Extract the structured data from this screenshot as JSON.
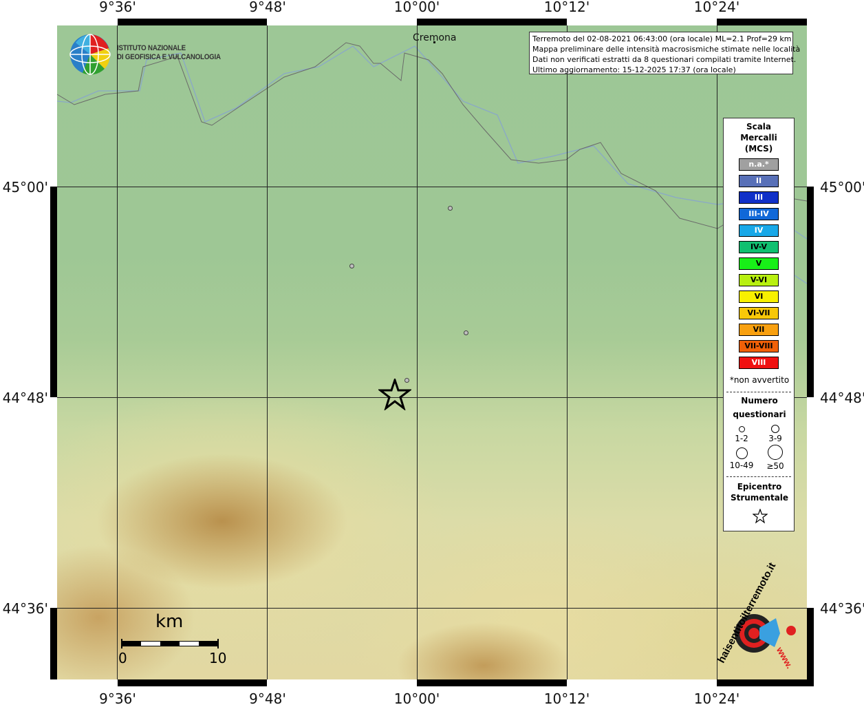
{
  "coordinates": {
    "top": [
      "9°36'",
      "9°48'",
      "10°00'",
      "10°12'",
      "10°24'"
    ],
    "bottom": [
      "9°36'",
      "9°48'",
      "10°00'",
      "10°12'",
      "10°24'"
    ],
    "left": [
      "45°00'",
      "44°48'",
      "44°36'"
    ],
    "right": [
      "45°00'",
      "44°48'",
      "44°36'"
    ]
  },
  "city": "Cremona",
  "logo": {
    "line1": "ISTITUTO NAZIONALE",
    "line2": "DI GEOFISICA E VULCANOLOGIA"
  },
  "info": {
    "line1": "Terremoto del 02-08-2021 06:43:00 (ora locale) ML=2.1 Prof=29 km",
    "line2": "Mappa preliminare delle intensità macrosismiche stimate nelle località",
    "line3": "Dati non verificati estratti da 8 questionari compilati tramite Internet.",
    "line4": "Ultimo aggiornamento: 15-12-2025 17:37 (ora locale)"
  },
  "legend": {
    "title_lines": [
      "Scala",
      "Mercalli",
      "(MCS)"
    ],
    "scale": [
      {
        "label": "n.a.*",
        "color": "#a0a0a0",
        "text_color": "#ffffff"
      },
      {
        "label": "II",
        "color": "#5870b8",
        "text_color": "#ffffff"
      },
      {
        "label": "III",
        "color": "#1030c8",
        "text_color": "#ffffff"
      },
      {
        "label": "III-IV",
        "color": "#1068d8",
        "text_color": "#ffffff"
      },
      {
        "label": "IV",
        "color": "#18a8e8",
        "text_color": "#ffffff"
      },
      {
        "label": "IV-V",
        "color": "#10c070",
        "text_color": "#000000"
      },
      {
        "label": "V",
        "color": "#18f018",
        "text_color": "#000000"
      },
      {
        "label": "V-VI",
        "color": "#b8f010",
        "text_color": "#000000"
      },
      {
        "label": "VI",
        "color": "#f8f000",
        "text_color": "#000000"
      },
      {
        "label": "VI-VII",
        "color": "#f8c808",
        "text_color": "#000000"
      },
      {
        "label": "VII",
        "color": "#f8a010",
        "text_color": "#000000"
      },
      {
        "label": "VII-VIII",
        "color": "#f06008",
        "text_color": "#000000"
      },
      {
        "label": "VIII",
        "color": "#f01010",
        "text_color": "#ffffff"
      }
    ],
    "note": "*non avvertito",
    "questionnaires_title_lines": [
      "Numero",
      "questionari"
    ],
    "questionnaire_sizes": [
      "1-2",
      "3-9",
      "10-49",
      "≥50"
    ],
    "epicenter_title_lines": [
      "Epicentro",
      "Strumentale"
    ]
  },
  "scalebar": {
    "unit": "km",
    "start": "0",
    "end": "10"
  },
  "bottom_logo": {
    "text": "haisentitoilterremoto.it",
    "www": "www."
  }
}
